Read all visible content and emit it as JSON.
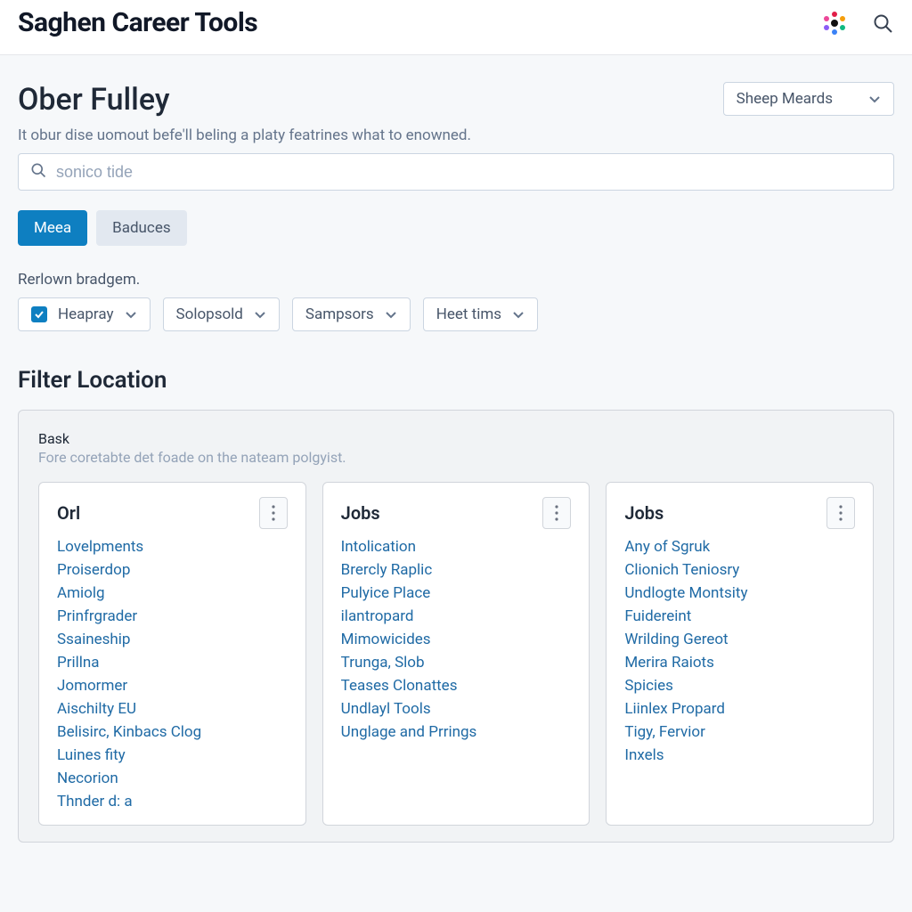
{
  "header": {
    "app_title": "Saghen Career Tools"
  },
  "page": {
    "title": "Ober Fulley",
    "subtitle": "It obur dise uomout befe'll beling a platy featrines what to enowned.",
    "sort_select": "Sheep Meards",
    "search_placeholder": "sonico tide"
  },
  "pills": {
    "primary": "Meea",
    "secondary": "Baduces"
  },
  "filter_label": "Rerlown bradgem.",
  "filter_chips": [
    "Heapray",
    "Solopsold",
    "Sampsors",
    "Heet tims"
  ],
  "section_heading": "Filter Location",
  "panel": {
    "label": "Bask",
    "sub": "Fore coretabte det foade on the nateam polgyist."
  },
  "cards": [
    {
      "title": "Orl",
      "links": [
        "Lovelpments",
        "Proiserdop",
        "Amiolg",
        "Prinfrgrader",
        "Ssaineship",
        "Prillna",
        "Jomormer",
        "Aischilty EU",
        "Belisirc, Kinbacs Clog",
        "Luines fity",
        "Necorion",
        "Thnder d: a"
      ]
    },
    {
      "title": "Jobs",
      "links": [
        "Intolication",
        "Brercly Raplic",
        "Pulyice Place",
        "ilantropard",
        "Mimowicides",
        "Trunga, Slob",
        "Teases Clonattes",
        "Undlayl Tools",
        "Unglage and Prrings"
      ]
    },
    {
      "title": "Jobs",
      "links": [
        "Any of Sgruk",
        "Clionich Teniosry",
        "Undlogte Montsity",
        "Fuidereint",
        "Wrilding Gereot",
        "Merira Raiots",
        "Spicies",
        "Liinlex Propard",
        "Tigy, Fervior",
        "Inxels"
      ]
    }
  ]
}
